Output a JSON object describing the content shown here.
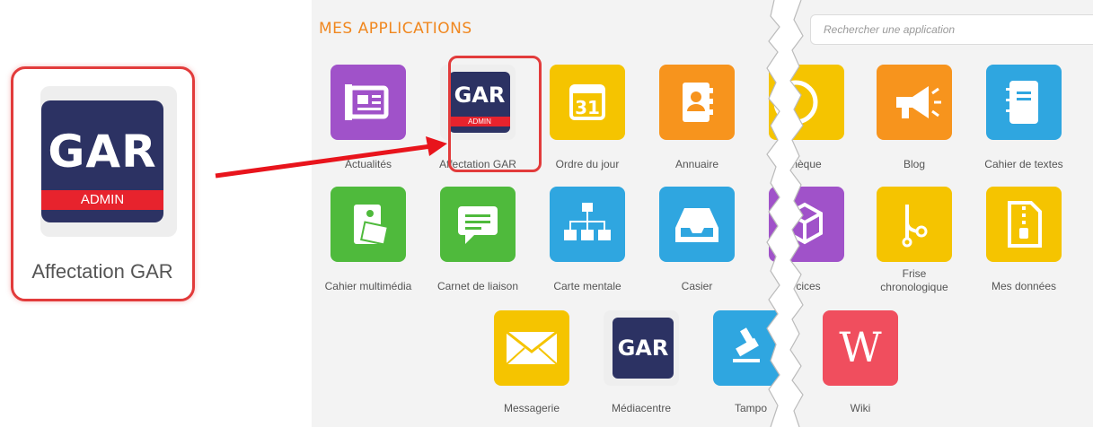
{
  "callout": {
    "label": "Affectation GAR",
    "logo_text": "GAR",
    "logo_badge": "ADMIN"
  },
  "header": {
    "title": "MES APPLICATIONS"
  },
  "search": {
    "placeholder": "Rechercher une application"
  },
  "apps": [
    {
      "label": "Actualités",
      "icon": "newspaper-icon",
      "color": "#a052c9"
    },
    {
      "label": "Affectation GAR",
      "icon": "gar-admin-icon",
      "color": "#2c3263"
    },
    {
      "label": "Ordre du jour",
      "icon": "calendar-icon",
      "color": "#f5c400"
    },
    {
      "label": "Annuaire",
      "icon": "address-book-icon",
      "color": "#f7941d"
    },
    {
      "label": "hèque",
      "icon": "clock-icon",
      "color": "#f5c400"
    },
    {
      "label": "Blog",
      "icon": "megaphone-icon",
      "color": "#f7941d"
    },
    {
      "label": "Cahier de textes",
      "icon": "notebook-icon",
      "color": "#2fa6e0"
    },
    {
      "label": "Cahier multimédia",
      "icon": "multimedia-notebook-icon",
      "color": "#4fba3c"
    },
    {
      "label": "Carnet de liaison",
      "icon": "chat-icon",
      "color": "#4fba3c"
    },
    {
      "label": "Carte mentale",
      "icon": "mindmap-icon",
      "color": "#2fa6e0"
    },
    {
      "label": "Casier",
      "icon": "inbox-tray-icon",
      "color": "#2fa6e0"
    },
    {
      "label": "rcices",
      "icon": "cube-icon",
      "color": "#a052c9"
    },
    {
      "label": "Frise chronologique",
      "icon": "timeline-icon",
      "color": "#f5c400"
    },
    {
      "label": "Mes données",
      "icon": "zip-file-icon",
      "color": "#f5c400"
    },
    {
      "label": "Messagerie",
      "icon": "envelope-icon",
      "color": "#f5c400"
    },
    {
      "label": "Médiacentre",
      "icon": "gar-icon",
      "color": "#2c3263"
    },
    {
      "label": "Tampo",
      "icon": "stamp-icon",
      "color": "#2fa6e0"
    },
    {
      "label": "Wiki",
      "icon": "wiki-icon",
      "color": "#f04e5e"
    }
  ],
  "gar_text": "GAR",
  "gar_badge": "ADMIN",
  "wiki_letter": "W"
}
